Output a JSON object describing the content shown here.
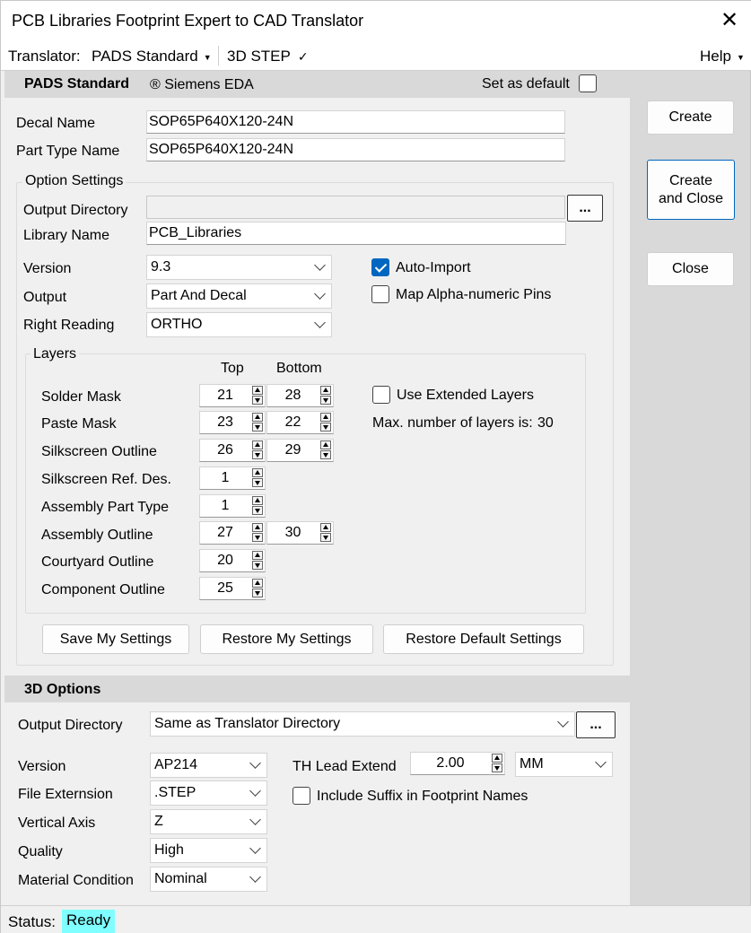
{
  "window": {
    "title": "PCB Libraries Footprint Expert to CAD Translator",
    "close_glyph": "✕"
  },
  "menubar": {
    "translator_label": "Translator:",
    "translator_value": "PADS Standard",
    "step_label": "3D STEP",
    "step_check": "✓",
    "help_label": "Help"
  },
  "header": {
    "title": "PADS Standard",
    "vendor": "® Siemens EDA",
    "set_default_label": "Set as default",
    "set_default_checked": false
  },
  "names": {
    "decal_label": "Decal Name",
    "decal_value": "SOP65P640X120-24N",
    "parttype_label": "Part Type Name",
    "parttype_value": "SOP65P640X120-24N"
  },
  "options": {
    "group_title": "Option Settings",
    "output_dir_label": "Output Directory",
    "output_dir_value": "",
    "browse_label": "...",
    "library_label": "Library Name",
    "library_value": "PCB_Libraries",
    "version_label": "Version",
    "version_value": "9.3",
    "output_label": "Output",
    "output_value": "Part And Decal",
    "right_reading_label": "Right Reading",
    "right_reading_value": "ORTHO",
    "auto_import_label": "Auto-Import",
    "auto_import_checked": true,
    "map_alpha_label": "Map Alpha-numeric Pins",
    "map_alpha_checked": false
  },
  "layers": {
    "group_title": "Layers",
    "col_top": "Top",
    "col_bottom": "Bottom",
    "rows": [
      {
        "label": "Solder Mask",
        "top": "21",
        "bottom": "28"
      },
      {
        "label": "Paste Mask",
        "top": "23",
        "bottom": "22"
      },
      {
        "label": "Silkscreen Outline",
        "top": "26",
        "bottom": "29"
      },
      {
        "label": "Silkscreen Ref. Des.",
        "top": "1"
      },
      {
        "label": "Assembly Part Type",
        "top": "1"
      },
      {
        "label": "Assembly Outline",
        "top": "27",
        "bottom": "30"
      },
      {
        "label": "Courtyard Outline",
        "top": "20"
      },
      {
        "label": "Component Outline",
        "top": "25"
      }
    ],
    "use_extended_label": "Use Extended Layers",
    "use_extended_checked": false,
    "max_layers_label": "Max. number of layers is:",
    "max_layers_value": "30"
  },
  "settings_buttons": {
    "save": "Save My Settings",
    "restore": "Restore My Settings",
    "restore_default": "Restore Default Settings"
  },
  "side_buttons": {
    "create": "Create",
    "create_close_1": "Create",
    "create_close_2": "and Close",
    "close": "Close"
  },
  "options3d": {
    "title": "3D Options",
    "output_dir_label": "Output Directory",
    "output_dir_value": "Same as Translator Directory",
    "browse_label": "...",
    "version_label": "Version",
    "version_value": "AP214",
    "file_ext_label": "File Externsion",
    "file_ext_value": ".STEP",
    "vertical_axis_label": "Vertical Axis",
    "vertical_axis_value": "Z",
    "quality_label": "Quality",
    "quality_value": "High",
    "material_label": "Material Condition",
    "material_value": "Nominal",
    "th_lead_label": "TH Lead Extend",
    "th_lead_value": "2.00",
    "th_lead_unit": "MM",
    "suffix_label": "Include Suffix in Footprint Names",
    "suffix_checked": false
  },
  "status": {
    "label": "Status:",
    "value": "Ready",
    "value_bg": "#7fffff"
  },
  "colors": {
    "accent": "#0067c0",
    "band": "#d9d9d9"
  }
}
